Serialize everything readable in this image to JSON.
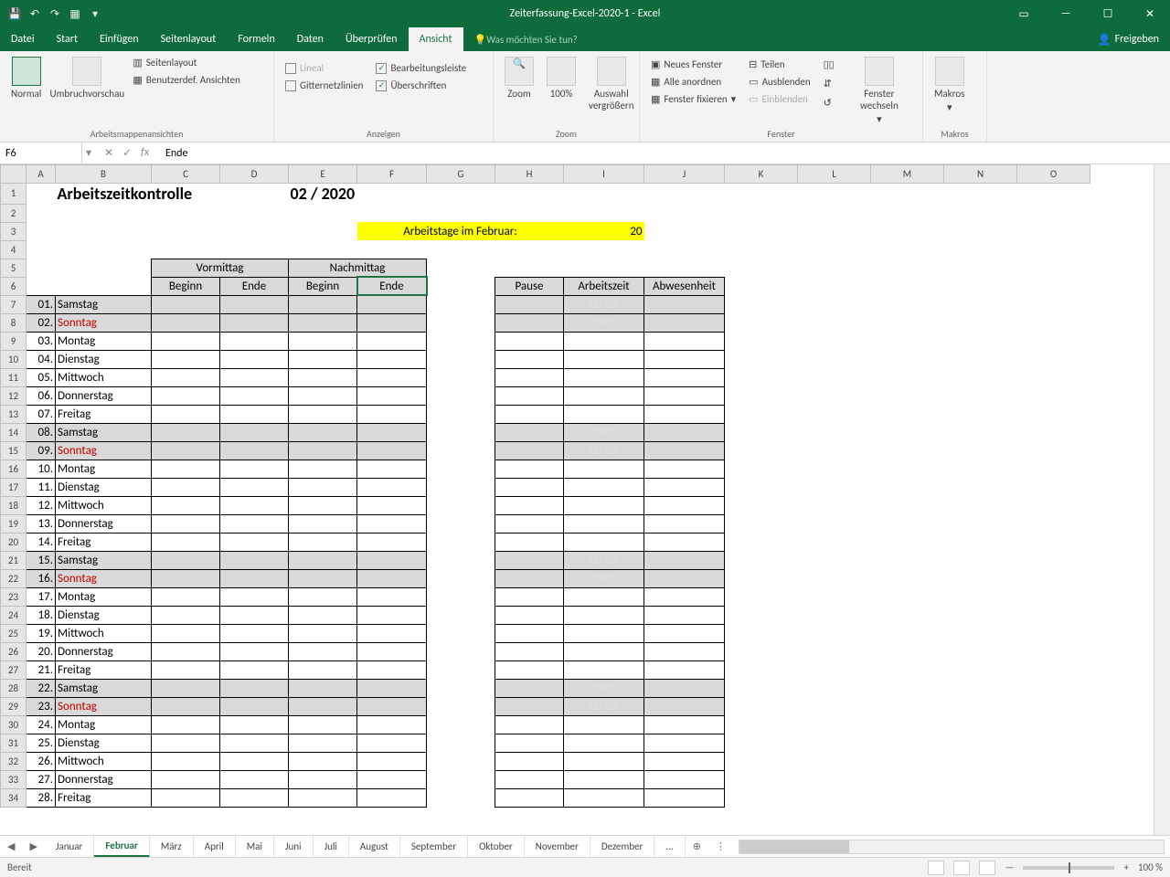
{
  "title": "Zeiterfassung-Excel-2020-1 - Excel",
  "menu": [
    "Datei",
    "Start",
    "Einfügen",
    "Seitenlayout",
    "Formeln",
    "Daten",
    "Überprüfen",
    "Ansicht"
  ],
  "tell": "Was möchten Sie tun?",
  "share": "Freigeben",
  "ribbon": {
    "views": {
      "normal": "Normal",
      "umbruch": "Umbruchvorschau",
      "seiten": "Seitenlayout",
      "benutzer": "Benutzerdef. Ansichten",
      "label": "Arbeitsmappenansichten"
    },
    "show": {
      "lineal": "Lineal",
      "bearb": "Bearbeitungsleiste",
      "gitter": "Gitternetzlinien",
      "uber": "Überschriften",
      "label": "Anzeigen"
    },
    "zoom": {
      "zoom": "Zoom",
      "hundred": "100%",
      "auswahl": "Auswahl vergrößern",
      "label": "Zoom"
    },
    "window": {
      "neues": "Neues Fenster",
      "alle": "Alle anordnen",
      "fix": "Fenster fixieren",
      "teilen": "Teilen",
      "aus": "Ausblenden",
      "ein": "Einblenden",
      "wechseln": "Fenster wechseln",
      "label": "Fenster"
    },
    "macros": {
      "makros": "Makros",
      "label": "Makros"
    }
  },
  "namebox": "F6",
  "formula": "Ende",
  "cols": [
    "A",
    "B",
    "C",
    "D",
    "E",
    "F",
    "G",
    "H",
    "I",
    "J",
    "K",
    "L",
    "M",
    "N",
    "O"
  ],
  "sheet": {
    "title": "Arbeitszeitkontrolle",
    "month": "02 / 2020",
    "arbLabel": "Arbeitstage im Februar:",
    "arbVal": "20",
    "vormittag": "Vormittag",
    "nachmittag": "Nachmittag",
    "beginn": "Beginn",
    "ende": "Ende",
    "pause": "Pause",
    "arbeitszeit": "Arbeitszeit",
    "abwesenheit": "Abwesenheit",
    "rows": [
      {
        "n": "01.",
        "d": "Samstag",
        "g": true,
        "t": "00:00"
      },
      {
        "n": "02.",
        "d": "Sonntag",
        "g": true,
        "r": true,
        "t": "00:00"
      },
      {
        "n": "03.",
        "d": "Montag"
      },
      {
        "n": "04.",
        "d": "Dienstag"
      },
      {
        "n": "05.",
        "d": "Mittwoch"
      },
      {
        "n": "06.",
        "d": "Donnerstag"
      },
      {
        "n": "07.",
        "d": "Freitag"
      },
      {
        "n": "08.",
        "d": "Samstag",
        "g": true,
        "t": "00:00"
      },
      {
        "n": "09.",
        "d": "Sonntag",
        "g": true,
        "r": true,
        "t": "00:00"
      },
      {
        "n": "10.",
        "d": "Montag"
      },
      {
        "n": "11.",
        "d": "Dienstag"
      },
      {
        "n": "12.",
        "d": "Mittwoch"
      },
      {
        "n": "13.",
        "d": "Donnerstag"
      },
      {
        "n": "14.",
        "d": "Freitag"
      },
      {
        "n": "15.",
        "d": "Samstag",
        "g": true,
        "t": "00:00"
      },
      {
        "n": "16.",
        "d": "Sonntag",
        "g": true,
        "r": true,
        "t": "00:00"
      },
      {
        "n": "17.",
        "d": "Montag"
      },
      {
        "n": "18.",
        "d": "Dienstag"
      },
      {
        "n": "19.",
        "d": "Mittwoch"
      },
      {
        "n": "20.",
        "d": "Donnerstag"
      },
      {
        "n": "21.",
        "d": "Freitag"
      },
      {
        "n": "22.",
        "d": "Samstag",
        "g": true,
        "t": "00:00"
      },
      {
        "n": "23.",
        "d": "Sonntag",
        "g": true,
        "r": true,
        "t": "00:00"
      },
      {
        "n": "24.",
        "d": "Montag"
      },
      {
        "n": "25.",
        "d": "Dienstag"
      },
      {
        "n": "26.",
        "d": "Mittwoch"
      },
      {
        "n": "27.",
        "d": "Donnerstag"
      },
      {
        "n": "28.",
        "d": "Freitag"
      }
    ]
  },
  "tabs": [
    "Januar",
    "Februar",
    "März",
    "April",
    "Mai",
    "Juni",
    "Juli",
    "August",
    "September",
    "Oktober",
    "November",
    "Dezember",
    "..."
  ],
  "activeTab": "Februar",
  "status": "Bereit",
  "zoom": "100 %"
}
